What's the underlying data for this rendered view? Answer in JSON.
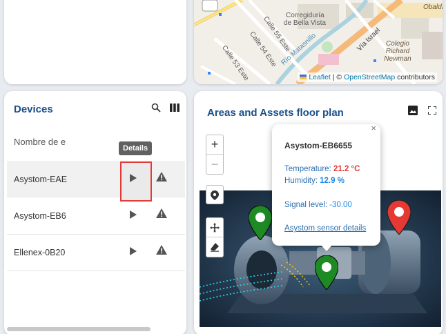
{
  "map": {
    "labels": {
      "corregiduria": "Corregiduría",
      "bella_vista": "de Bella Vista",
      "calle55": "Calle 55 Este",
      "calle54": "Calle 54 Este",
      "calle53": "Calle 53 Este",
      "via_israel": "Vía Israel",
      "colegio": "Colegio\nRichard\nNewman",
      "obaldia": "Obaldí",
      "rio": "Río Matasnillo"
    },
    "attribution": {
      "leaflet": "Leaflet",
      "sep": " | © ",
      "osm": "OpenStreetMap",
      "contrib": " contributors"
    }
  },
  "devices": {
    "title": "Devices",
    "column_header": "Nombre de e",
    "tooltip": "Details",
    "rows": [
      {
        "name": "Asystom-EAE"
      },
      {
        "name": "Asystom-EB6"
      },
      {
        "name": "Ellenex-0B20"
      }
    ]
  },
  "floorplan": {
    "title": "Areas and Assets floor plan",
    "zoom_in": "+",
    "zoom_out": "−",
    "popup": {
      "name": "Asystom-EB6655",
      "temp_label": "Temperature: ",
      "temp_value": "21.2 °C",
      "hum_label": "Humidity: ",
      "hum_value": "12.9 %",
      "signal_label": "Signal level: ",
      "signal_value": "-30.00",
      "link": "Asystom sensor details",
      "close": "×"
    }
  },
  "colors": {
    "title": "#1a4f8b",
    "highlight_box": "#e53935",
    "marker_green": "#1e8a24",
    "marker_red": "#e53935"
  }
}
